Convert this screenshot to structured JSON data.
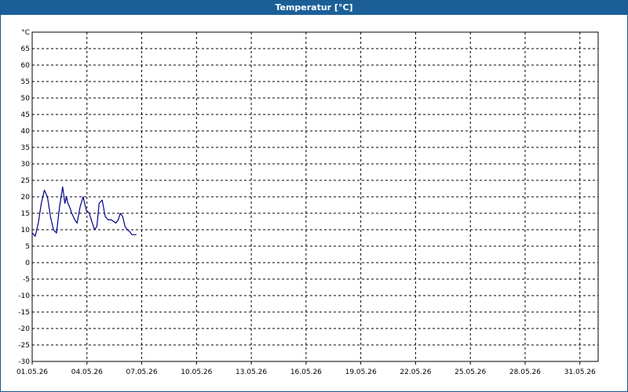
{
  "window": {
    "title": "Temperatur [°C]"
  },
  "chart_data": {
    "type": "line",
    "unit_label": "°C",
    "ylim": [
      -30,
      70
    ],
    "y_ticks": [
      65,
      60,
      55,
      50,
      45,
      40,
      35,
      30,
      25,
      20,
      15,
      10,
      5,
      0,
      -5,
      -10,
      -15,
      -20,
      -25,
      -30
    ],
    "xlim": [
      "01.05.26 00:00",
      "01.06.26 00:00"
    ],
    "x_ticks": [
      "01.05.26",
      "04.05.26",
      "07.05.26",
      "10.05.26",
      "13.05.26",
      "16.05.26",
      "19.05.26",
      "22.05.26",
      "25.05.26",
      "28.05.26",
      "31.05.26"
    ],
    "grid": true,
    "line_color": "#00008b",
    "series": [
      {
        "x": [
          "01.05.26 00:00",
          "01.05.26 04:00",
          "01.05.26 08:00",
          "01.05.26 12:00",
          "01.05.26 16:00",
          "01.05.26 20:00",
          "02.05.26 00:00",
          "02.05.26 04:00",
          "02.05.26 08:00",
          "02.05.26 12:00",
          "02.05.26 16:00",
          "02.05.26 19:00",
          "02.05.26 21:00",
          "02.05.26 23:00",
          "03.05.26 01:00",
          "03.05.26 04:00",
          "03.05.26 08:00",
          "03.05.26 11:00",
          "03.05.26 15:00",
          "03.05.26 19:00",
          "03.05.26 23:00",
          "04.05.26 03:00",
          "04.05.26 07:00",
          "04.05.26 10:00",
          "04.05.26 13:00",
          "04.05.26 16:00",
          "04.05.26 20:00",
          "05.05.26 00:00",
          "05.05.26 04:00",
          "05.05.26 08:00",
          "05.05.26 11:00",
          "05.05.26 14:00",
          "05.05.26 17:00",
          "05.05.26 20:00",
          "05.05.26 23:00",
          "06.05.26 02:00",
          "06.05.26 05:00",
          "06.05.26 08:00",
          "06.05.26 11:00",
          "06.05.26 14:00",
          "06.05.26 17:00"
        ],
        "values": [
          9,
          8,
          12,
          18,
          22,
          20,
          14,
          10,
          9,
          17,
          23,
          18,
          20,
          18,
          17,
          15,
          13,
          12,
          17,
          20,
          16,
          15,
          12,
          10,
          11,
          18,
          19,
          14,
          13,
          13,
          12.5,
          12,
          13,
          15,
          14,
          11,
          10,
          9.5,
          8.5,
          8.5,
          8.5
        ]
      }
    ]
  }
}
